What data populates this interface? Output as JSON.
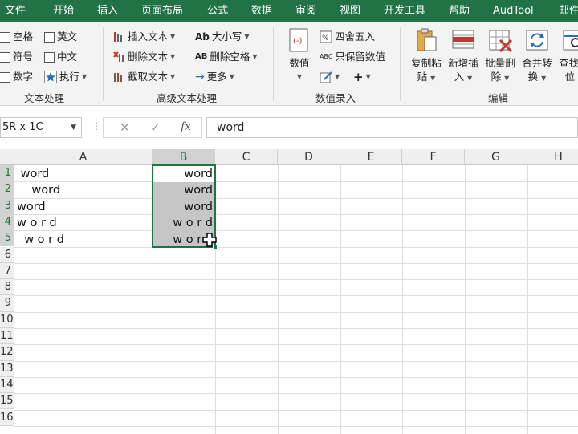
{
  "menu": {
    "tabs": [
      "文件",
      "开始",
      "插入",
      "页面布局",
      "公式",
      "数据",
      "审阅",
      "视图",
      "开发工具",
      "帮助",
      "AudTool",
      "邮件"
    ]
  },
  "ribbon": {
    "text_group": {
      "items": [
        "空格",
        "英文",
        "符号",
        "中文",
        "数字",
        "执行"
      ],
      "name": "文本处理"
    },
    "advanced_group": {
      "insert": "插入文本",
      "delete": "删除文本",
      "extract": "截取文本",
      "case_icon": "Ab",
      "case": "大小写",
      "remove_space_icon": "AB",
      "remove_space": "删除空格",
      "more": "更多",
      "name": "高级文本处理"
    },
    "entry_group": {
      "value": "数值",
      "round": "四舍五入",
      "keep_icon": "ABC",
      "keep": "只保留数值",
      "name": "数值录入"
    },
    "edit_group": {
      "copy_paste": [
        "复制粘",
        "贴"
      ],
      "add_insert": [
        "新增插",
        "入"
      ],
      "batch_delete": [
        "批量删",
        "除"
      ],
      "merge_convert": [
        "合并转",
        "换"
      ],
      "find_locate": [
        "查找定",
        "位"
      ],
      "name": "编辑"
    }
  },
  "formula_bar": {
    "name_box": "5R x 1C",
    "fx": "fx",
    "content": "word"
  },
  "grid": {
    "columns": [
      "A",
      "B",
      "C",
      "D",
      "E",
      "F",
      "G",
      "H"
    ],
    "rows": [
      "1",
      "2",
      "3",
      "4",
      "5",
      "6",
      "7",
      "8",
      "9",
      "10",
      "11",
      "12",
      "13",
      "14",
      "15",
      "16"
    ],
    "col_a": [
      " word",
      "    word",
      "word",
      "w o r d",
      "  w o r d"
    ],
    "col_b": [
      "word",
      "word",
      "word",
      "w o r d",
      "w o r d"
    ]
  },
  "colors": {
    "accent": "#217346",
    "selection": "#c6c6c6"
  }
}
